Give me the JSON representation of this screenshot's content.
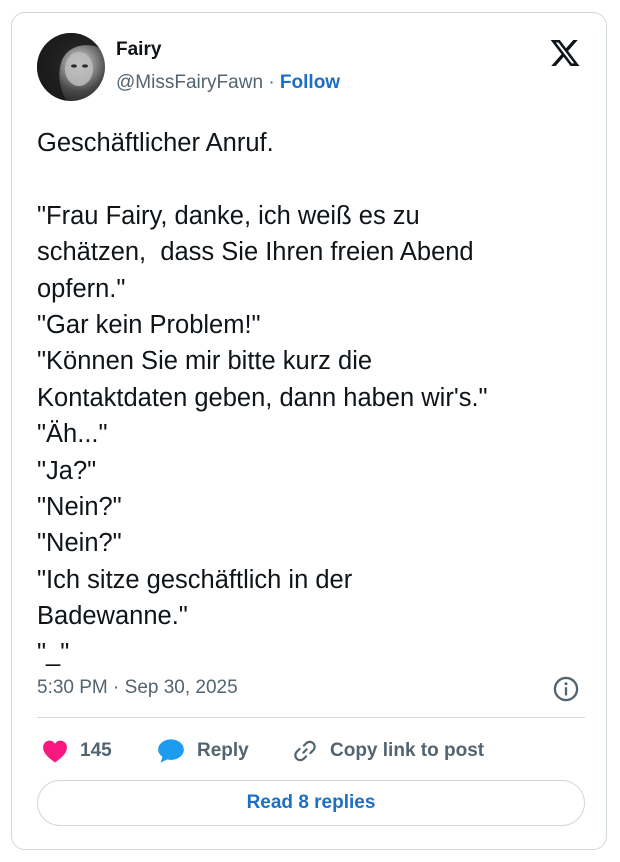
{
  "author": {
    "name": "Fairy",
    "handle": "@MissFairyFawn",
    "separator": "·",
    "follow_label": "Follow"
  },
  "tweet": {
    "lines": [
      "Geschäftlicher Anruf.",
      "",
      "\"Frau Fairy, danke, ich weiß es zu",
      "schätzen,  dass Sie Ihren freien Abend",
      "opfern.\"",
      "\"Gar kein Problem!\"",
      "\"Können Sie mir bitte kurz die",
      "Kontaktdaten geben, dann haben wir's.\"",
      "\"Äh...\"",
      "\"Ja?\"",
      "\"Nein?\"",
      "\"Nein?\"",
      "\"Ich sitze geschäftlich in der",
      "Badewanne.\"",
      "\"_\""
    ],
    "timestamp": "5:30 PM · Sep 30, 2025"
  },
  "actions": {
    "like_count": "145",
    "reply_label": "Reply",
    "copy_label": "Copy link to post"
  },
  "footer": {
    "read_replies_label": "Read 8 replies"
  },
  "icons": {
    "logo": "x-logo-icon",
    "info": "info-icon",
    "like": "heart-icon",
    "reply": "speech-bubble-icon",
    "copy": "link-icon"
  },
  "colors": {
    "like": "#f91880",
    "reply": "#1d9bf0",
    "link_text": "#1d6fc2",
    "secondary_text": "#536471",
    "border": "#cfd9de"
  }
}
